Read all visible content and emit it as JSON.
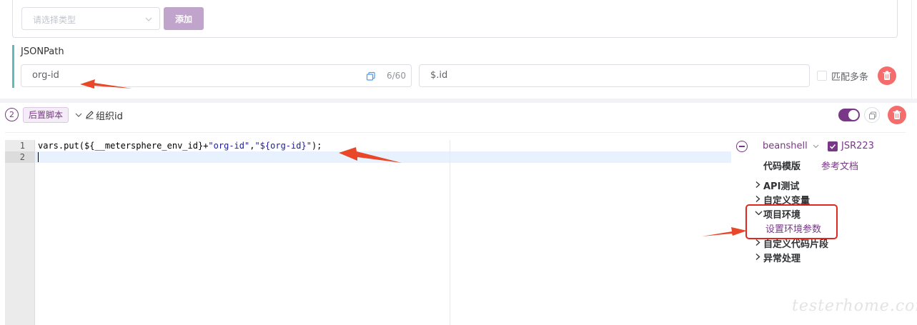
{
  "extractor": {
    "type_select_placeholder": "请选择类型",
    "add_label": "添加",
    "jsonpath_label": "JSONPath",
    "var_name": "org-id",
    "var_name_count": "6/60",
    "expression": "$.id",
    "multi_match_label": "匹配多条"
  },
  "script": {
    "step_number": "2",
    "tag_label": "后置脚本",
    "name": "组织id",
    "enabled": true,
    "line_numbers": [
      "1",
      "2"
    ],
    "code_lines": [
      {
        "prefix": "vars.put(${__metersphere_env_id}+",
        "str1": "\"org-id\"",
        "mid": ",",
        "str2": "\"${org-id}\"",
        "suffix": ");"
      },
      {
        "prefix": "",
        "str1": "",
        "mid": "",
        "str2": "",
        "suffix": ""
      }
    ],
    "language": "beanshell",
    "jsr223_label": "JSR223",
    "jsr223_checked": true,
    "template_title": "代码模版",
    "reference_doc": "参考文档",
    "tree": [
      {
        "label": "API测试",
        "expanded": false
      },
      {
        "label": "自定义变量",
        "expanded": false
      },
      {
        "label": "项目环境",
        "expanded": true
      },
      {
        "label": "自定义代码片段",
        "expanded": false
      },
      {
        "label": "异常处理",
        "expanded": false
      }
    ],
    "tree_child": "设置环境参数"
  },
  "watermark": "testerhome.com",
  "colors": {
    "accent": "#783887",
    "danger": "#f56c6c",
    "teal": "#5fbdb9",
    "annotation": "#e8472a"
  }
}
